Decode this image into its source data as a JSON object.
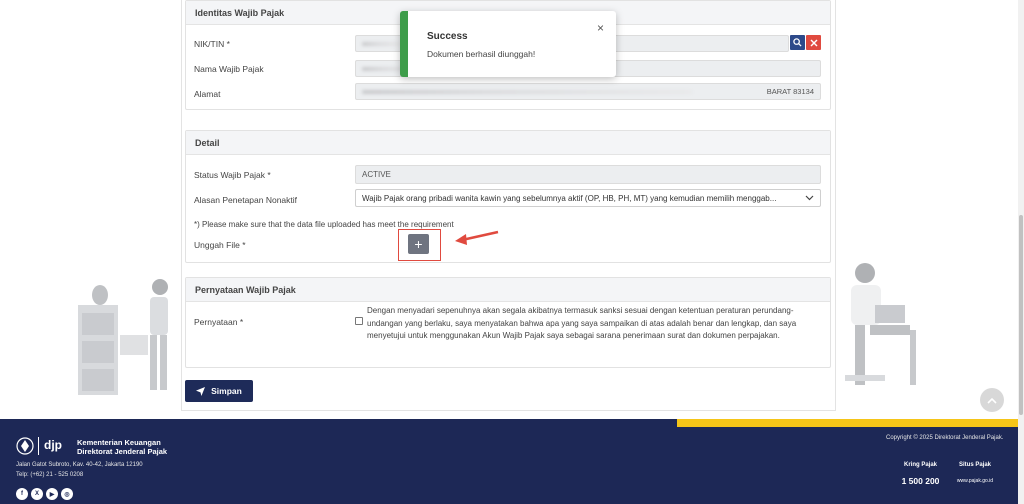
{
  "identitas": {
    "header": "Identitas Wajib Pajak",
    "nik_label": "NIK/TIN *",
    "nama_label": "Nama Wajib Pajak",
    "alamat_label": "Alamat",
    "alamat_suffix": "BARAT 83134"
  },
  "detail": {
    "header": "Detail",
    "status_label": "Status Wajib Pajak *",
    "status_value": "ACTIVE",
    "alasan_label": "Alasan Penetapan Nonaktif",
    "alasan_value": "Wajib Pajak orang pribadi wanita kawin yang sebelumnya aktif (OP, HB, PH, MT) yang kemudian memilih menggab...",
    "note": "*) Please make sure that the data file uploaded has meet the requirement",
    "unggah_label": "Unggah File *",
    "upload_plus": "+"
  },
  "pernyataan": {
    "header": "Pernyataan Wajib Pajak",
    "label": "Pernyataan *",
    "text_line1": "Dengan menyadari sepenuhnya akan segala akibatnya termasuk sanksi sesuai dengan ketentuan peraturan perundang-",
    "text_line2": "undangan yang berlaku, saya menyatakan bahwa apa yang saya sampaikan di atas adalah benar dan lengkap, dan saya",
    "text_line3": "menyetujui untuk menggunakan Akun Wajib Pajak saya sebagai sarana penerimaan surat dan dokumen perpajakan."
  },
  "simpan_label": "Simpan",
  "toast": {
    "title": "Success",
    "message": "Dokumen berhasil diunggah!",
    "close": "×"
  },
  "footer": {
    "djp": "djp",
    "ministry_line1": "Kementerian Keuangan",
    "ministry_line2": "Direktorat Jenderal Pajak",
    "address": "Jalan Gatot Subroto, Kav. 40-42, Jakarta 12190",
    "phone": "Telp: (+62) 21 - 525 0208",
    "copyright": "Copyright © 2025 Direktorat Jenderal Pajak.",
    "kring_label": "Kring Pajak",
    "kring_number": "1 500 200",
    "situs_label": "Situs Pajak",
    "situs_url": "www.pajak.go.id"
  },
  "colors": {
    "primary": "#1e2b59",
    "success": "#3e9d4a",
    "danger": "#e04a3f",
    "accent": "#f5c518"
  }
}
